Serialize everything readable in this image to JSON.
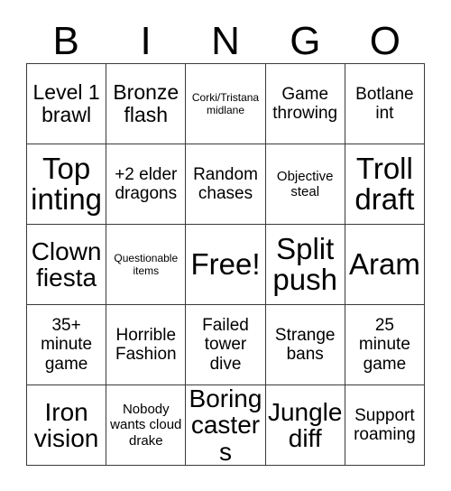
{
  "card": {
    "header_letters": [
      "B",
      "I",
      "N",
      "G",
      "O"
    ],
    "columns": 5,
    "rows": 5,
    "free_space_label": "Free!",
    "free_space_index": 12,
    "border_color": "#3a3a3a",
    "background_color": "#ffffff",
    "text_color": "#000000",
    "cells": [
      {
        "text": "Level 1 brawl",
        "size": "lg"
      },
      {
        "text": "Bronze flash",
        "size": "lg"
      },
      {
        "text": "Corki/Tristana midlane",
        "size": "xs"
      },
      {
        "text": "Game throwing",
        "size": "md"
      },
      {
        "text": "Botlane int",
        "size": "md"
      },
      {
        "text": "Top inting",
        "size": "xxl"
      },
      {
        "text": "+2 elder dragons",
        "size": "md"
      },
      {
        "text": "Random chases",
        "size": "md"
      },
      {
        "text": "Objective steal",
        "size": "sm"
      },
      {
        "text": "Troll draft",
        "size": "xxl"
      },
      {
        "text": "Clown fiesta",
        "size": "xl"
      },
      {
        "text": "Questionable items",
        "size": "xs"
      },
      {
        "text": "Free!",
        "size": "xxl"
      },
      {
        "text": "Split push",
        "size": "xxl"
      },
      {
        "text": "Aram",
        "size": "xxl"
      },
      {
        "text": "35+ minute game",
        "size": "md"
      },
      {
        "text": "Horrible Fashion",
        "size": "md"
      },
      {
        "text": "Failed tower dive",
        "size": "md"
      },
      {
        "text": "Strange bans",
        "size": "md"
      },
      {
        "text": "25 minute game",
        "size": "md"
      },
      {
        "text": "Iron vision",
        "size": "xl"
      },
      {
        "text": "Nobody wants cloud drake",
        "size": "sm"
      },
      {
        "text": "Boring casters",
        "size": "xl"
      },
      {
        "text": "Jungle diff",
        "size": "xl"
      },
      {
        "text": "Support roaming",
        "size": "md"
      }
    ]
  }
}
